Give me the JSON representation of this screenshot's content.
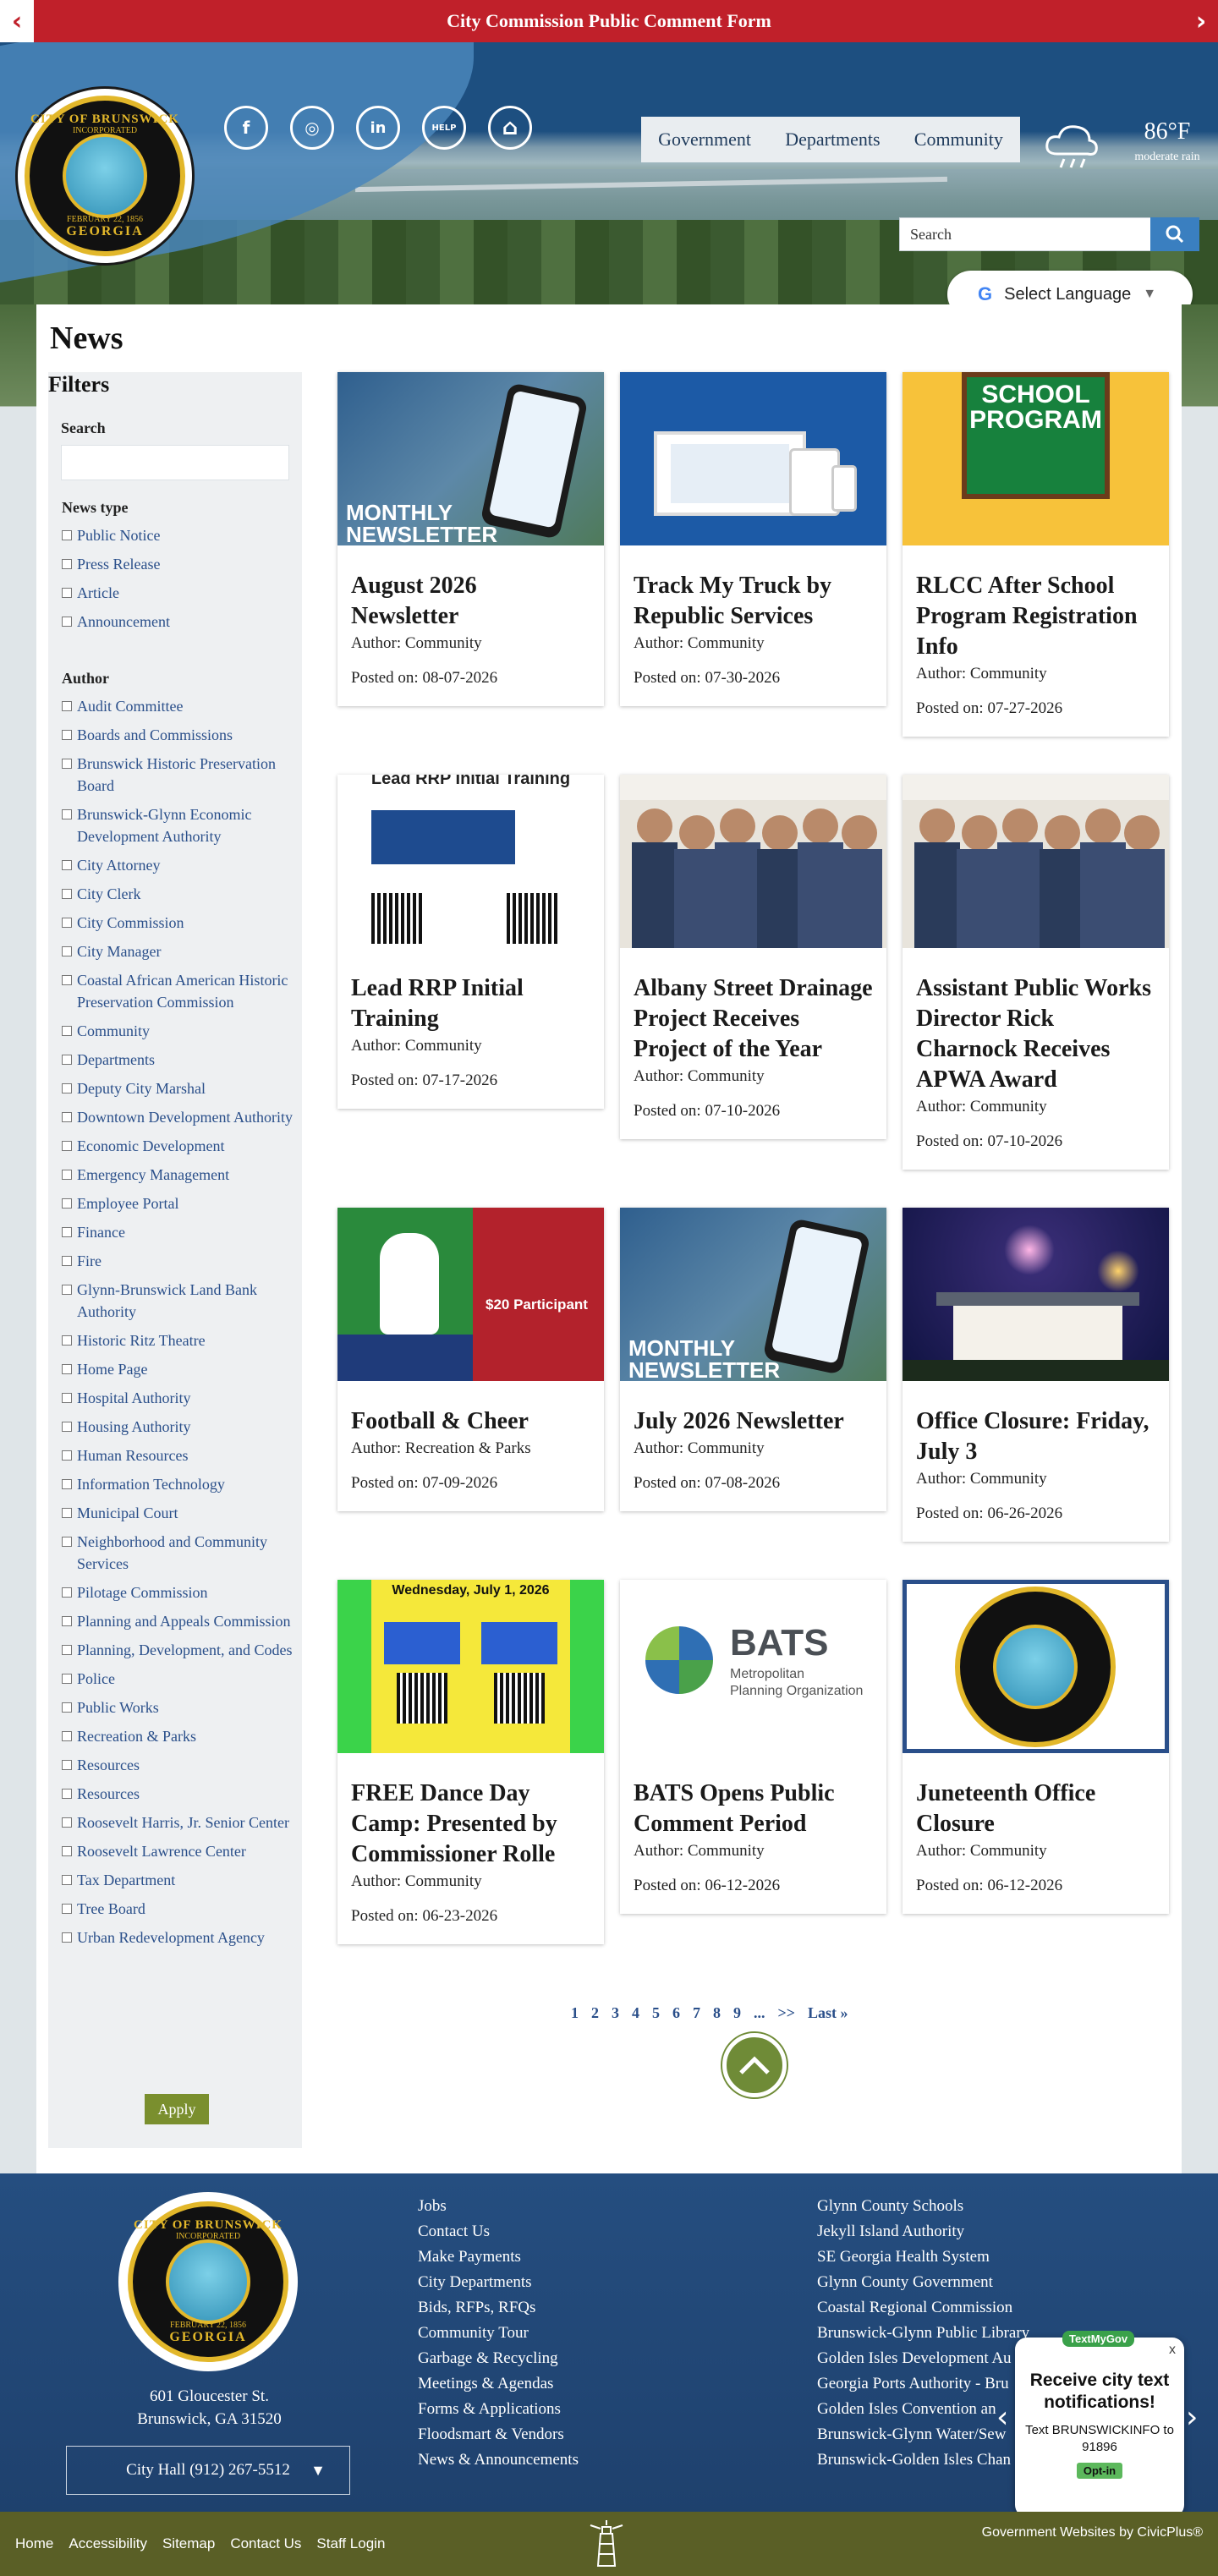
{
  "alert": {
    "title": "City Commission Public Comment Form"
  },
  "header": {
    "logo": {
      "top": "CITY OF BRUNSWICK",
      "mid": "INCORPORATED",
      "date": "FEBRUARY 22, 1856",
      "bottom": "GEORGIA"
    },
    "socials": [
      {
        "icon": "facebook-icon",
        "glyph": "f"
      },
      {
        "icon": "instagram-icon",
        "glyph": "◎"
      },
      {
        "icon": "linkedin-icon",
        "glyph": "in"
      },
      {
        "icon": "help-icon",
        "glyph": "HELP"
      },
      {
        "icon": "home-icon",
        "glyph": "⌂"
      }
    ],
    "nav": [
      "Government",
      "Departments",
      "Community"
    ],
    "weather": {
      "temp": "86°F",
      "condition": "moderate rain"
    },
    "search": {
      "placeholder": "Search"
    },
    "language": {
      "label": "Select Language",
      "g": "G",
      "caret": "▼"
    }
  },
  "page": {
    "title": "News"
  },
  "filters": {
    "title": "Filters",
    "search_label": "Search",
    "news_type_label": "News type",
    "news_types": [
      "Public Notice",
      "Press Release",
      "Article",
      "Announcement"
    ],
    "author_label": "Author",
    "authors": [
      "Audit Committee",
      "Boards and Commissions",
      "Brunswick Historic Preservation Board",
      "Brunswick-Glynn Economic Development Authority",
      "City Attorney",
      "City Clerk",
      "City Commission",
      "City Manager",
      "Coastal African American Historic Preservation Commission",
      "Community",
      "Departments",
      "Deputy City Marshal",
      "Downtown Development Authority",
      "Economic Development",
      "Emergency Management",
      "Employee Portal",
      "Finance",
      "Fire",
      "Glynn-Brunswick Land Bank Authority",
      "Historic Ritz Theatre",
      "Home Page",
      "Hospital Authority",
      "Housing Authority",
      "Human Resources",
      "Information Technology",
      "Municipal Court",
      "Neighborhood and Community Services",
      "Pilotage Commission",
      "Planning and Appeals Commission",
      "Planning, Development, and Codes",
      "Police",
      "Public Works",
      "Recreation & Parks",
      "Resources",
      "Resources",
      "Roosevelt Harris, Jr. Senior Center",
      "Roosevelt Lawrence Center",
      "Tax Department",
      "Tree Board",
      "Urban Redevelopment Agency"
    ],
    "apply_label": "Apply"
  },
  "news": [
    {
      "title": "August 2026 Newsletter",
      "author": "Author: Community",
      "date": "Posted on: 08-07-2026",
      "image": "newsletter",
      "img_caption": "MONTHLY NEWSLETTER"
    },
    {
      "title": "Track My Truck by Republic Services",
      "author": "Author: Community",
      "date": "Posted on: 07-30-2026",
      "image": "devices",
      "img_caption": ""
    },
    {
      "title": "RLCC After School Program Registration Info",
      "author": "Author: Community",
      "date": "Posted on: 07-27-2026",
      "image": "school",
      "img_caption": "SCHOOL PROGRAM"
    },
    {
      "title": "Lead RRP Initial Training",
      "author": "Author: Community",
      "date": "Posted on: 07-17-2026",
      "image": "flyer",
      "img_caption": "Lead RRP Initial Training"
    },
    {
      "title": "Albany Street Drainage Project Receives Project of the Year",
      "author": "Author: Community",
      "date": "Posted on: 07-10-2026",
      "image": "group",
      "img_caption": ""
    },
    {
      "title": "Assistant Public Works Director Rick Charnock Receives APWA Award",
      "author": "Author: Community",
      "date": "Posted on: 07-10-2026",
      "image": "group2",
      "img_caption": ""
    },
    {
      "title": "Football & Cheer",
      "author": "Author: Recreation & Parks",
      "date": "Posted on: 07-09-2026",
      "image": "football",
      "img_caption": "$20 Participant"
    },
    {
      "title": "July 2026 Newsletter",
      "author": "Author: Community",
      "date": "Posted on: 07-08-2026",
      "image": "newsletter",
      "img_caption": "MONTHLY NEWSLETTER"
    },
    {
      "title": "Office Closure: Friday, July 3",
      "author": "Author: Community",
      "date": "Posted on: 06-26-2026",
      "image": "fireworks",
      "img_caption": ""
    },
    {
      "title": "FREE Dance Day Camp: Presented by Commissioner Rolle",
      "author": "Author: Community",
      "date": "Posted on: 06-23-2026",
      "image": "dance",
      "img_caption": "Wednesday, July 1, 2026"
    },
    {
      "title": "BATS Opens Public Comment Period",
      "author": "Author: Community",
      "date": "Posted on: 06-12-2026",
      "image": "bats",
      "img_caption": "BATS"
    },
    {
      "title": "Juneteenth Office Closure",
      "author": "Author: Community",
      "date": "Posted on: 06-12-2026",
      "image": "seal",
      "img_caption": ""
    }
  ],
  "pager": [
    "1",
    "2",
    "3",
    "4",
    "5",
    "6",
    "7",
    "8",
    "9",
    "...",
    ">>",
    "Last »"
  ],
  "footer": {
    "address_line1": "601 Gloucester St.",
    "address_line2": "Brunswick, GA 31520",
    "phone_label": "City Hall (912) 267-5512",
    "col1": [
      "Jobs",
      "Contact Us",
      "Make Payments",
      "City Departments",
      "Bids, RFPs, RFQs",
      "Community Tour",
      "Garbage & Recycling",
      "Meetings & Agendas",
      "Forms & Applications",
      "Floodsmart & Vendors",
      "News & Announcements"
    ],
    "col2": [
      "Glynn County Schools",
      "Jekyll Island Authority",
      "SE Georgia Health System",
      "Glynn County Government",
      "Coastal Regional Commission",
      "Brunswick-Glynn Public Library",
      "Golden Isles Development Au",
      "Georgia Ports Authority - Bru",
      "Golden Isles Convention an",
      "Brunswick-Glynn Water/Sew",
      "Brunswick-Golden Isles Chan"
    ]
  },
  "textmy": {
    "badge": "TextMyGov",
    "close": "x",
    "heading": "Receive city text notifications!",
    "sub": "Text BRUNSWICKINFO to 91896",
    "optin": "Opt-in"
  },
  "bottombar": {
    "links": [
      "Home",
      "Accessibility",
      "Sitemap",
      "Contact Us",
      "Staff Login"
    ],
    "credit": "Government Websites by CivicPlus®"
  },
  "colors": {
    "alert": "#c0202a",
    "navy": "#254e80",
    "olive": "#5a5f26",
    "link": "#2a4f8a",
    "apply": "#7a8f2e"
  }
}
